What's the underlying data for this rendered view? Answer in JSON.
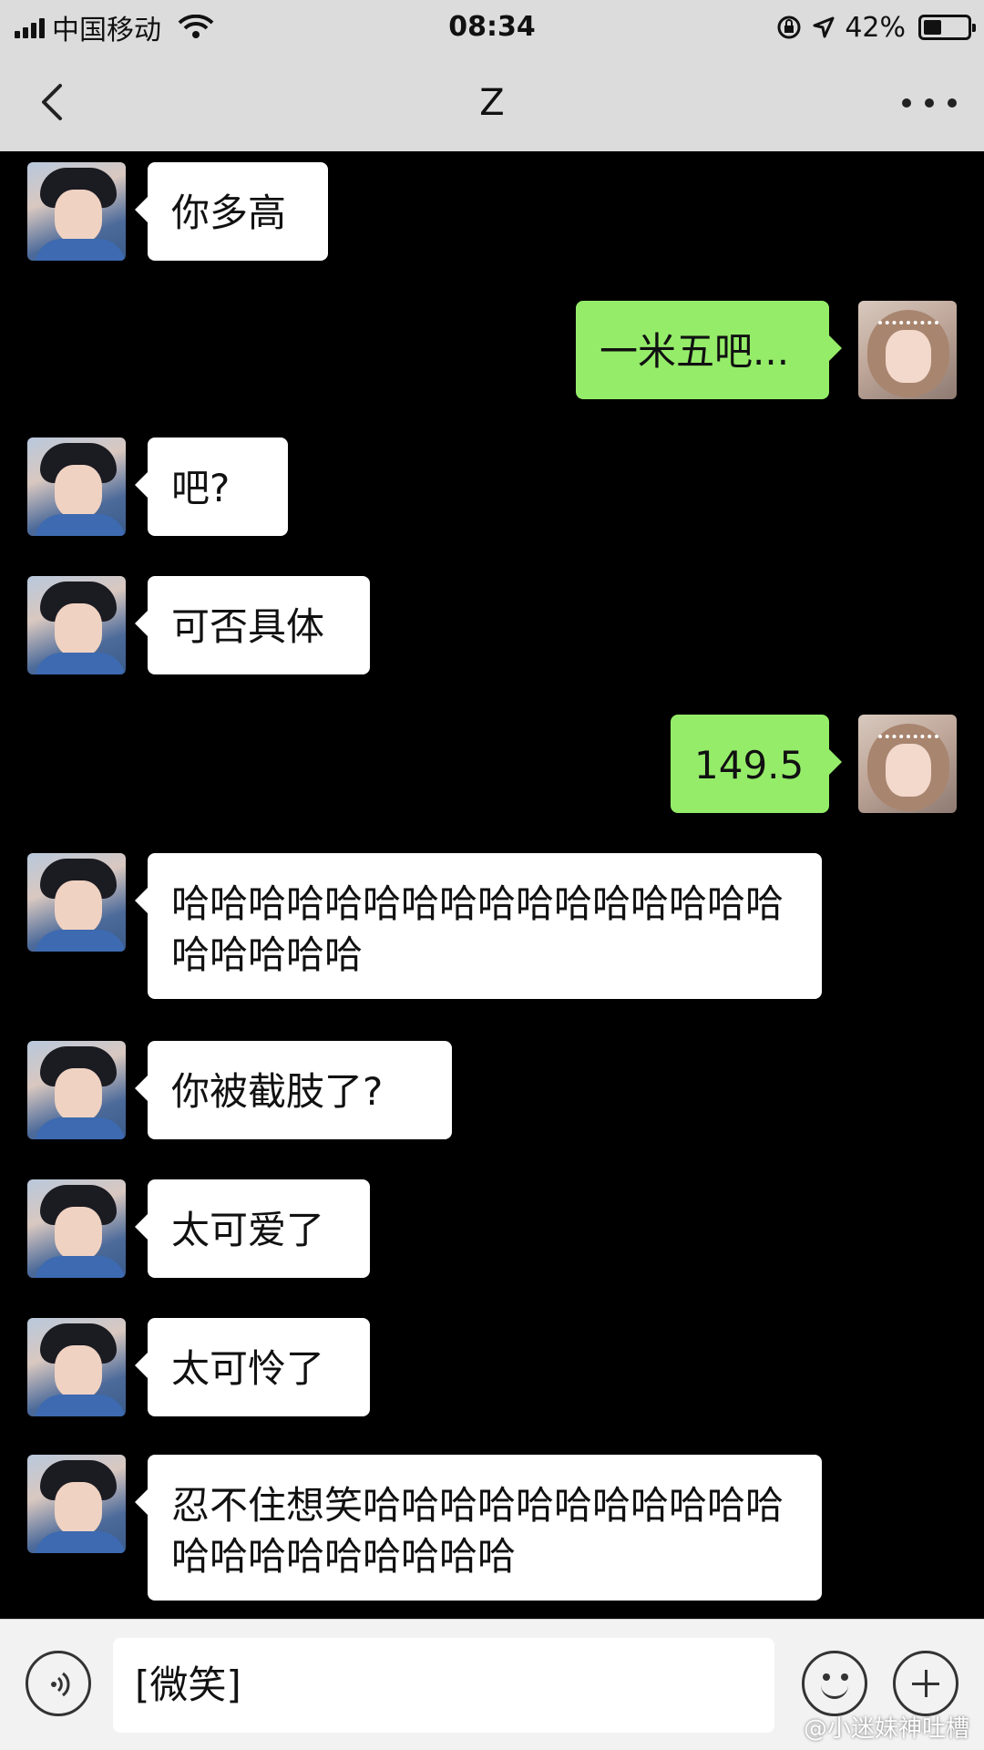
{
  "status_bar": {
    "carrier": "中国移动",
    "time": "08:34",
    "battery_percent": "42%",
    "battery_level": 0.42,
    "icons": [
      "signal-icon",
      "wifi-icon",
      "rotation-lock-icon",
      "location-arrow-icon",
      "battery-icon"
    ]
  },
  "nav": {
    "title": "Z",
    "back_icon": "chevron-left-icon",
    "more_icon": "more-dots-icon"
  },
  "messages": [
    {
      "side": "left",
      "text": "你多高"
    },
    {
      "side": "right",
      "text": "一米五吧..."
    },
    {
      "side": "left",
      "text": "吧?"
    },
    {
      "side": "left",
      "text": "可否具体"
    },
    {
      "side": "right",
      "text": "149.5"
    },
    {
      "side": "left",
      "text": "哈哈哈哈哈哈哈哈哈哈哈哈哈哈哈哈哈哈哈哈哈"
    },
    {
      "side": "left",
      "text": "你被截肢了?"
    },
    {
      "side": "left",
      "text": "太可爱了"
    },
    {
      "side": "left",
      "text": "太可怜了"
    },
    {
      "side": "left",
      "text": "忍不住想笑哈哈哈哈哈哈哈哈哈哈哈哈哈哈哈哈哈哈哈哈"
    }
  ],
  "input": {
    "value": "[微笑]",
    "voice_icon": "voice-icon",
    "emoji_icon": "emoji-icon",
    "plus_icon": "plus-icon"
  },
  "watermark": "@小迷妹神吐槽",
  "colors": {
    "bar_bg": "#dcdcdc",
    "chat_bg": "#000000",
    "sent_bubble": "#95ec69",
    "received_bubble": "#ffffff"
  }
}
